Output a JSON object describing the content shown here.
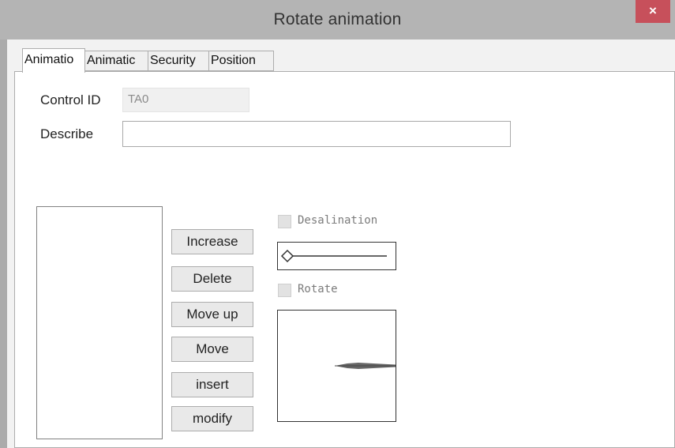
{
  "window": {
    "title": "Rotate animation",
    "close_label": "×"
  },
  "tabs": [
    {
      "label": "Animatio",
      "active": true
    },
    {
      "label": "Animatic",
      "active": false
    },
    {
      "label": "Security",
      "active": false
    },
    {
      "label": "Position",
      "active": false
    }
  ],
  "form": {
    "control_id_label": "Control ID",
    "control_id_value": "TA0",
    "describe_label": "Describe",
    "describe_value": ""
  },
  "buttons": {
    "increase": "Increase",
    "delete": "Delete",
    "move_up": "Move up",
    "move": "Move",
    "insert": "insert",
    "modify": "modify"
  },
  "options": {
    "desalination_label": "Desalination",
    "desalination_checked": false,
    "rotate_label": "Rotate",
    "rotate_checked": false,
    "slider_value": 0
  },
  "colors": {
    "close_button": "#c7505b",
    "titlebar": "#b4b4b4",
    "preview_shape": "#666666"
  }
}
